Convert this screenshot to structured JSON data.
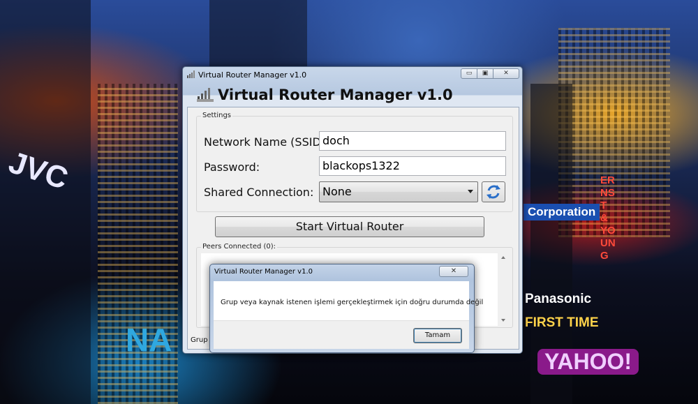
{
  "window": {
    "title": "Virtual Router Manager v1.0",
    "header_title": "Virtual Router Manager v1.0",
    "minimize_glyph": "▭",
    "maximize_glyph": "▣",
    "close_glyph": "✕"
  },
  "settings": {
    "group_label": "Settings",
    "ssid_label": "Network Name (SSID):",
    "ssid_value": "doch",
    "password_label": "Password:",
    "password_value": "blackops1322",
    "shared_label": "Shared Connection:",
    "shared_value": "None"
  },
  "start_button_label": "Start Virtual Router",
  "peers": {
    "group_label": "Peers Connected (0):"
  },
  "status_text": "Grup v",
  "dialog": {
    "title": "Virtual Router Manager v1.0",
    "close_glyph": "✕",
    "message": "Grup veya kaynak istenen işlemi gerçekleştirmek için doğru durumda değil",
    "ok_label": "Tamam"
  },
  "background": {
    "signs": [
      "Corporation",
      "Panasonic",
      "FIRST TIME",
      "YAHOO!",
      "ERNST & YOUNG",
      "JVC",
      "NA"
    ]
  }
}
